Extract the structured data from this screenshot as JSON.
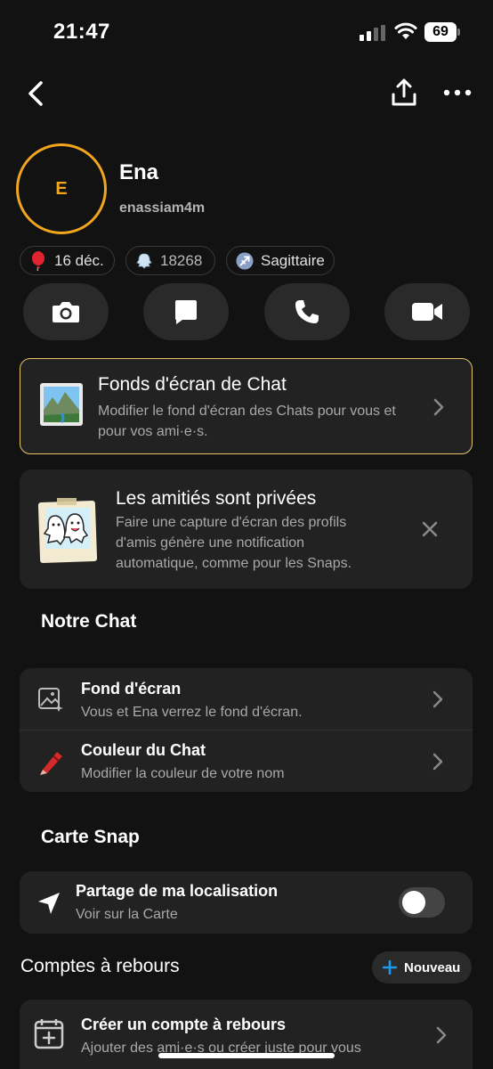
{
  "status": {
    "time": "21:47",
    "battery": "69"
  },
  "header": {
    "back_icon": "chevron-left-icon",
    "share_icon": "share-icon",
    "more_icon": "more-dots-icon"
  },
  "profile": {
    "initial": "E",
    "name": "Ena",
    "username": "enassiam4m",
    "chips": [
      {
        "icon": "balloon-icon",
        "label": "16 déc."
      },
      {
        "icon": "ghost-icon",
        "label": "18268"
      },
      {
        "icon": "sagittarius-icon",
        "label": "Sagittaire"
      }
    ],
    "actions": [
      "camera-icon",
      "chat-icon",
      "phone-icon",
      "video-icon"
    ]
  },
  "wallpaper_promo": {
    "title": "Fonds d'écran de Chat",
    "subtitle": "Modifier le fond d'écran des Chats pour vous et pour vos ami·e·s."
  },
  "friendship_notice": {
    "title": "Les amitiés sont privées",
    "subtitle": "Faire une capture d'écran des profils d'amis génère une notification automatique, comme pour les Snaps."
  },
  "our_chat": {
    "heading": "Notre Chat",
    "items": [
      {
        "title": "Fond d'écran",
        "subtitle": "Vous et Ena verrez le fond d'écran."
      },
      {
        "title": "Couleur du Chat",
        "subtitle": "Modifier la couleur de votre nom"
      }
    ]
  },
  "snap_map": {
    "heading": "Carte Snap",
    "title": "Partage de ma localisation",
    "subtitle": "Voir sur la Carte",
    "toggle_on": false
  },
  "countdowns": {
    "heading": "Comptes à rebours",
    "new_label": "Nouveau",
    "item_title": "Créer un compte à rebours",
    "item_subtitle": "Ajouter des ami·e·s ou créer juste pour vous"
  },
  "colors": {
    "accent": "#f2a51f",
    "background": "#121212",
    "card": "#222222",
    "blue": "#1a9bf0"
  }
}
